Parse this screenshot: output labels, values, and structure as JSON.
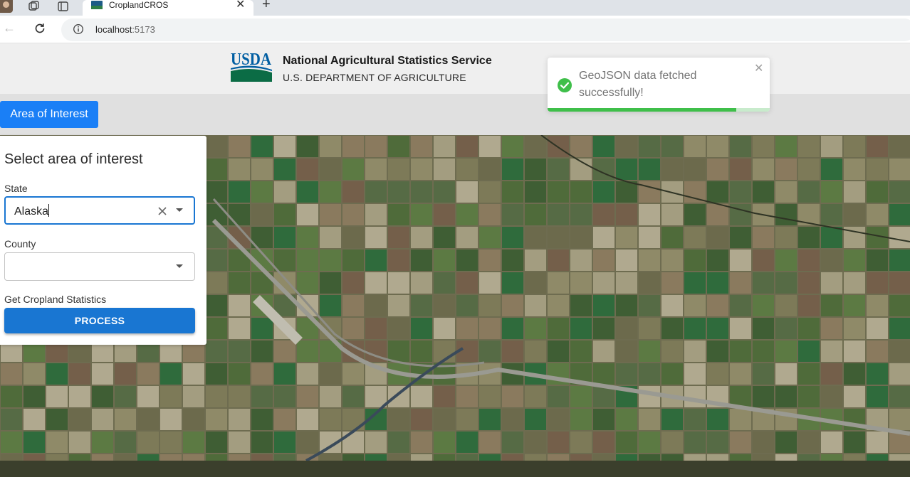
{
  "browser": {
    "tab_title": "CroplandCROS",
    "url_host": "localhost",
    "url_port": ":5173",
    "icons": [
      "avatar",
      "workspaces-icon",
      "tab-actions-icon",
      "close-icon",
      "new-tab-icon",
      "back-icon",
      "reload-icon",
      "info-icon"
    ]
  },
  "header": {
    "logo_text": "USDA",
    "org_name": "National Agricultural Statistics Service",
    "dept_name": "U.S. DEPARTMENT OF AGRICULTURE"
  },
  "nav": {
    "aoi_button": "Area of Interest"
  },
  "panel": {
    "title": "Select area of interest",
    "state_label": "State",
    "state_value": "Alaska",
    "county_label": "County",
    "county_value": "",
    "stats_label": "Get Cropland Statistics",
    "process_button": "PROCESS"
  },
  "toast": {
    "message": "GeoJSON data fetched successfully!",
    "progress_fraction": 0.85,
    "colors": {
      "success": "#3fbf4a",
      "text": "#757575"
    }
  },
  "colors": {
    "primary": "#1976d2",
    "aoi_button": "#1a7ff6",
    "usda_blue": "#005ea2",
    "usda_green": "#0b6c45"
  }
}
